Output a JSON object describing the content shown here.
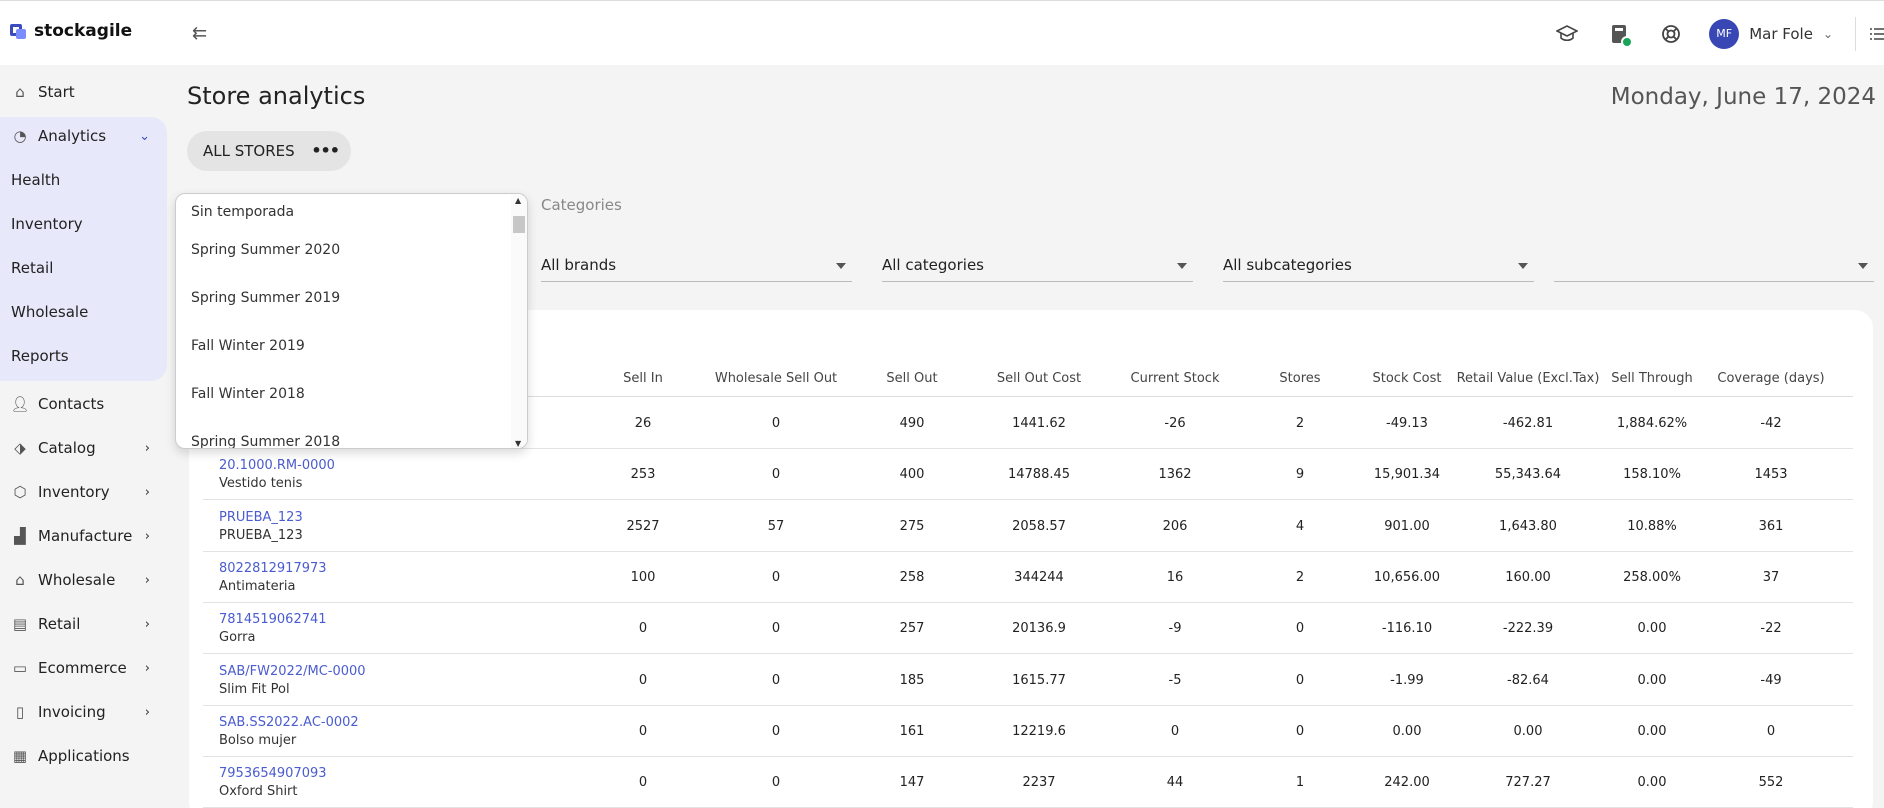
{
  "app": {
    "logo": "stockagile",
    "collapse_icon": "collapse-sidebar-icon"
  },
  "topbar": {
    "user_initials": "MF",
    "user_name": "Mar Fole",
    "icons": [
      "academy-icon",
      "printer-status-icon",
      "support-icon",
      "menu-list-icon"
    ]
  },
  "sidebar": {
    "start": "Start",
    "analytics": "Analytics",
    "analytics_sub": [
      "Health",
      "Inventory",
      "Retail",
      "Wholesale",
      "Reports"
    ],
    "items": [
      "Contacts",
      "Catalog",
      "Inventory",
      "Manufacture",
      "Wholesale",
      "Retail",
      "Ecommerce",
      "Invoicing",
      "Applications"
    ]
  },
  "main": {
    "title": "Store analytics",
    "date": "Monday, June 17, 2024",
    "store_chip": "ALL STORES",
    "tab_categories": "Categories",
    "filters": [
      "All brands",
      "All categories",
      "All subcategories",
      ""
    ]
  },
  "dropdown": {
    "options": [
      "Sin temporada",
      "Spring Summer 2020",
      "Spring Summer 2019",
      "Fall Winter 2019",
      "Fall Winter 2018",
      "Spring Summer 2018"
    ]
  },
  "table": {
    "headers": [
      "Sell In",
      "Wholesale Sell Out",
      "Sell Out",
      "Sell Out Cost",
      "Current Stock",
      "Stores",
      "Stock Cost",
      "Retail Value (Excl.Tax)",
      "Sell Through",
      "Coverage (days)"
    ],
    "rows": [
      {
        "code": "",
        "name": "",
        "values": [
          "26",
          "0",
          "490",
          "1441.62",
          "-26",
          "2",
          "-49.13",
          "-462.81",
          "1,884.62%",
          "-42"
        ]
      },
      {
        "code": "20.1000.RM-0000",
        "name": "Vestido tenis",
        "values": [
          "253",
          "0",
          "400",
          "14788.45",
          "1362",
          "9",
          "15,901.34",
          "55,343.64",
          "158.10%",
          "1453"
        ]
      },
      {
        "code": "PRUEBA_123",
        "name": "PRUEBA_123",
        "values": [
          "2527",
          "57",
          "275",
          "2058.57",
          "206",
          "4",
          "901.00",
          "1,643.80",
          "10.88%",
          "361"
        ]
      },
      {
        "code": "8022812917973",
        "name": "Antimateria",
        "values": [
          "100",
          "0",
          "258",
          "344244",
          "16",
          "2",
          "10,656.00",
          "160.00",
          "258.00%",
          "37"
        ]
      },
      {
        "code": "7814519062741",
        "name": "Gorra",
        "values": [
          "0",
          "0",
          "257",
          "20136.9",
          "-9",
          "0",
          "-116.10",
          "-222.39",
          "0.00",
          "-22"
        ]
      },
      {
        "code": "SAB/FW2022/MC-0000",
        "name": "Slim Fit Pol",
        "values": [
          "0",
          "0",
          "185",
          "1615.77",
          "-5",
          "0",
          "-1.99",
          "-82.64",
          "0.00",
          "-49"
        ]
      },
      {
        "code": "SAB.SS2022.AC-0002",
        "name": "Bolso mujer",
        "values": [
          "0",
          "0",
          "161",
          "12219.6",
          "0",
          "0",
          "0.00",
          "0.00",
          "0.00",
          "0"
        ]
      },
      {
        "code": "7953654907093",
        "name": "Oxford Shirt",
        "values": [
          "0",
          "0",
          "147",
          "2237",
          "44",
          "1",
          "242.00",
          "727.27",
          "0.00",
          "552"
        ]
      }
    ]
  }
}
